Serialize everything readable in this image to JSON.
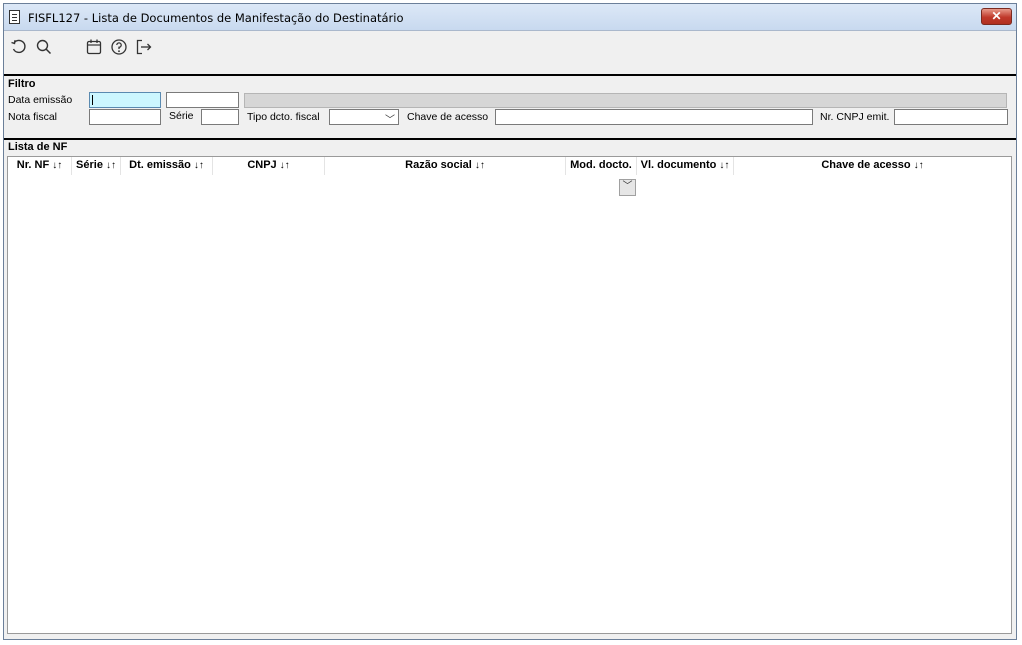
{
  "window": {
    "title": "FISFL127 - Lista de Documentos de Manifestação do Destinatário",
    "close_label": "✕"
  },
  "toolbar": {
    "buttons": [
      "undo-icon",
      "search-icon",
      "calendar-icon",
      "help-icon",
      "exit-icon"
    ]
  },
  "filter": {
    "title": "Filtro",
    "data_emissao_label": "Data emissão",
    "data_emissao_from": "",
    "data_emissao_to": "",
    "nota_fiscal_label": "Nota fiscal",
    "nota_fiscal_value": "",
    "serie_label": "Série",
    "serie_value": "",
    "tipo_label": "Tipo dcto. fiscal",
    "tipo_value": "",
    "chave_label": "Chave de acesso",
    "chave_value": "",
    "cnpj_label": "Nr. CNPJ emit.",
    "cnpj_value": ""
  },
  "list": {
    "title": "Lista de NF",
    "sort_glyph": "↓↑",
    "columns": [
      {
        "label": "Nr. NF",
        "sortable": true
      },
      {
        "label": "Série",
        "sortable": true
      },
      {
        "label": "Dt. emissão",
        "sortable": true
      },
      {
        "label": "CNPJ",
        "sortable": true
      },
      {
        "label": "Razão social",
        "sortable": true
      },
      {
        "label": "Mod. docto.",
        "sortable": false
      },
      {
        "label": "Vl. documento",
        "sortable": true
      },
      {
        "label": "Chave de acesso",
        "sortable": true
      }
    ],
    "rows": []
  },
  "colors": {
    "active_input": "#ccf7ff",
    "close_button": "#c0392b"
  }
}
